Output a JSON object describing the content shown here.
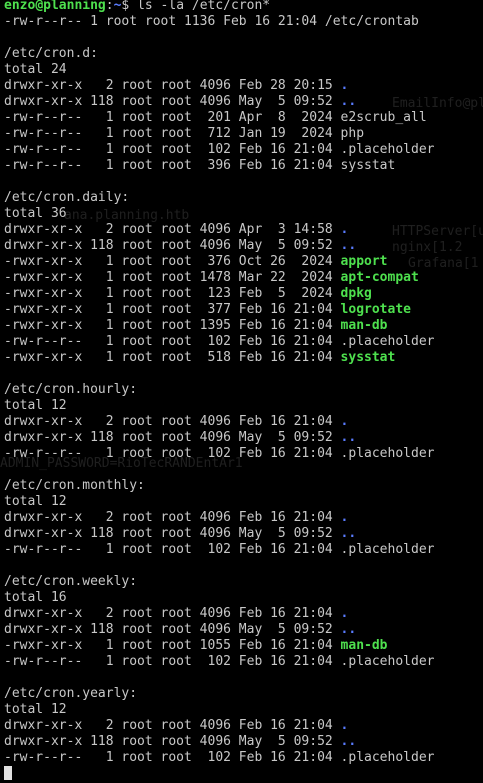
{
  "prompt": {
    "user": "enzo",
    "at": "@",
    "host": "planning",
    "colon": ":",
    "path": "~",
    "symbol": "$",
    "command": "ls -la /etc/cron*"
  },
  "crontab_line": "-rw-r--r-- 1 root root 1136 Feb 16 21:04 /etc/crontab",
  "colors": {
    "background": "#000000",
    "text": "#c8c8c8",
    "directory": "#5a7cff",
    "executable": "#4ee04e"
  },
  "sections": [
    {
      "header": "/etc/cron.d:",
      "total": "total 24",
      "entries": [
        {
          "meta": "drwxr-xr-x   2 root root 4096 Feb 28 20:15 ",
          "name": ".",
          "type": "dir"
        },
        {
          "meta": "drwxr-xr-x 118 root root 4096 May  5 09:52 ",
          "name": "..",
          "type": "dir"
        },
        {
          "meta": "-rw-r--r--   1 root root  201 Apr  8  2024 ",
          "name": "e2scrub_all",
          "type": "file"
        },
        {
          "meta": "-rw-r--r--   1 root root  712 Jan 19  2024 ",
          "name": "php",
          "type": "file"
        },
        {
          "meta": "-rw-r--r--   1 root root  102 Feb 16 21:04 ",
          "name": ".placeholder",
          "type": "file"
        },
        {
          "meta": "-rw-r--r--   1 root root  396 Feb 16 21:04 ",
          "name": "sysstat",
          "type": "file"
        }
      ]
    },
    {
      "header": "/etc/cron.daily:",
      "total": "total 36",
      "entries": [
        {
          "meta": "drwxr-xr-x   2 root root 4096 Apr  3 14:58 ",
          "name": ".",
          "type": "dir"
        },
        {
          "meta": "drwxr-xr-x 118 root root 4096 May  5 09:52 ",
          "name": "..",
          "type": "dir"
        },
        {
          "meta": "-rwxr-xr-x   1 root root  376 Oct 26  2024 ",
          "name": "apport",
          "type": "exec"
        },
        {
          "meta": "-rwxr-xr-x   1 root root 1478 Mar 22  2024 ",
          "name": "apt-compat",
          "type": "exec"
        },
        {
          "meta": "-rwxr-xr-x   1 root root  123 Feb  5  2024 ",
          "name": "dpkg",
          "type": "exec"
        },
        {
          "meta": "-rwxr-xr-x   1 root root  377 Feb 16 21:04 ",
          "name": "logrotate",
          "type": "exec"
        },
        {
          "meta": "-rwxr-xr-x   1 root root 1395 Feb 16 21:04 ",
          "name": "man-db",
          "type": "exec"
        },
        {
          "meta": "-rw-r--r--   1 root root  102 Feb 16 21:04 ",
          "name": ".placeholder",
          "type": "file"
        },
        {
          "meta": "-rwxr-xr-x   1 root root  518 Feb 16 21:04 ",
          "name": "sysstat",
          "type": "exec"
        }
      ]
    },
    {
      "header": "/etc/cron.hourly:",
      "total": "total 12",
      "entries": [
        {
          "meta": "drwxr-xr-x   2 root root 4096 Feb 16 21:04 ",
          "name": ".",
          "type": "dir"
        },
        {
          "meta": "drwxr-xr-x 118 root root 4096 May  5 09:52 ",
          "name": "..",
          "type": "dir"
        },
        {
          "meta": "-rw-r--r--   1 root root  102 Feb 16 21:04 ",
          "name": ".placeholder",
          "type": "file"
        }
      ]
    },
    {
      "header": "/etc/cron.monthly:",
      "total": "total 12",
      "entries": [
        {
          "meta": "drwxr-xr-x   2 root root 4096 Feb 16 21:04 ",
          "name": ".",
          "type": "dir"
        },
        {
          "meta": "drwxr-xr-x 118 root root 4096 May  5 09:52 ",
          "name": "..",
          "type": "dir"
        },
        {
          "meta": "-rw-r--r--   1 root root  102 Feb 16 21:04 ",
          "name": ".placeholder",
          "type": "file"
        }
      ]
    },
    {
      "header": "/etc/cron.weekly:",
      "total": "total 16",
      "entries": [
        {
          "meta": "drwxr-xr-x   2 root root 4096 Feb 16 21:04 ",
          "name": ".",
          "type": "dir"
        },
        {
          "meta": "drwxr-xr-x 118 root root 4096 May  5 09:52 ",
          "name": "..",
          "type": "dir"
        },
        {
          "meta": "-rwxr-xr-x   1 root root 1055 Feb 16 21:04 ",
          "name": "man-db",
          "type": "exec"
        },
        {
          "meta": "-rw-r--r--   1 root root  102 Feb 16 21:04 ",
          "name": ".placeholder",
          "type": "file"
        }
      ]
    },
    {
      "header": "/etc/cron.yearly:",
      "total": "total 12",
      "entries": [
        {
          "meta": "drwxr-xr-x   2 root root 4096 Feb 16 21:04 ",
          "name": ".",
          "type": "dir"
        },
        {
          "meta": "drwxr-xr-x 118 root root 4096 May  5 09:52 ",
          "name": "..",
          "type": "dir"
        },
        {
          "meta": "-rw-r--r--   1 root root  102 Feb 16 21:04 ",
          "name": ".placeholder",
          "type": "file"
        }
      ]
    }
  ],
  "ghost_text": [
    "EmailInfo@pl",
    "ana.planning.htb",
    "HTTPServer[u",
    "nginx[1.2",
    "Grafana[1",
    "ADMIN_PASSWORD=RioTecRANDEntAr1"
  ]
}
